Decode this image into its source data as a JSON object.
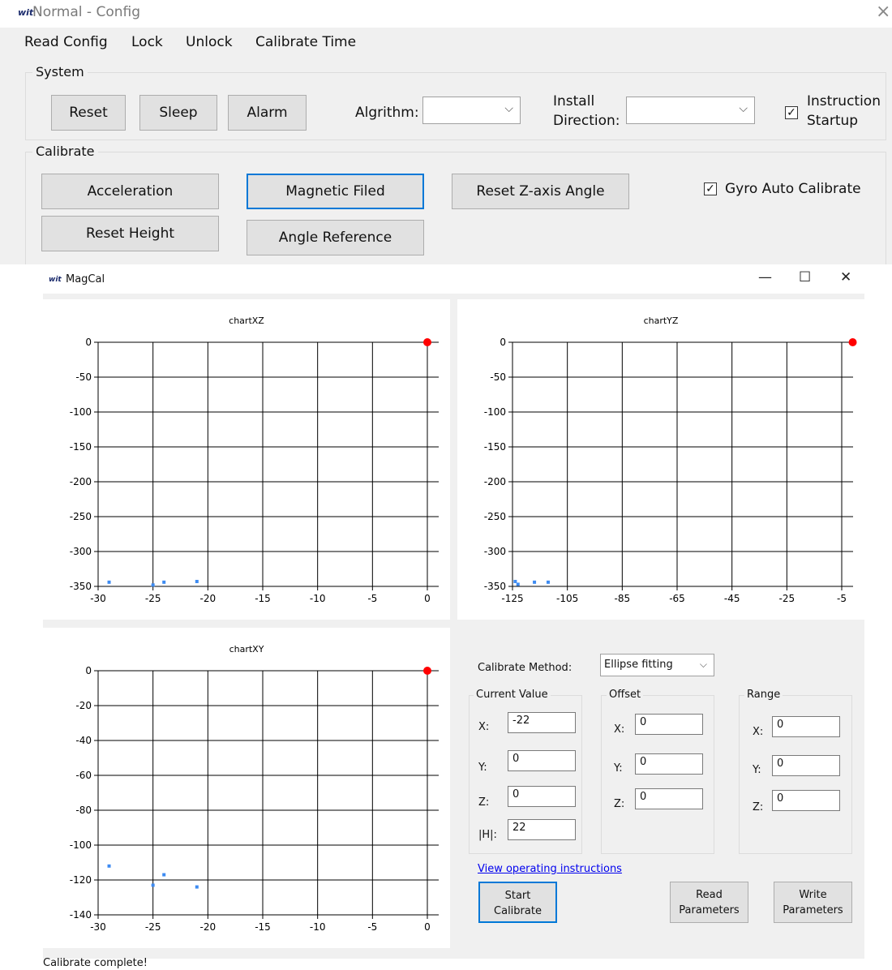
{
  "config_window": {
    "title": "Normal - Config",
    "logo_text": "wit",
    "close_glyph": "×",
    "menu": [
      "Read Config",
      "Lock",
      "Unlock",
      "Calibrate Time"
    ],
    "system": {
      "label": "System",
      "buttons": [
        "Reset",
        "Sleep",
        "Alarm"
      ],
      "algorithm_label": "Algrithm:",
      "algorithm_value": "",
      "install_label_1": "Install",
      "install_label_2": "Direction:",
      "install_value": "",
      "instruction_label_1": "Instruction",
      "instruction_label_2": "Startup",
      "instruction_checked": true
    },
    "calibrate": {
      "label": "Calibrate",
      "acceleration": "Acceleration",
      "magnetic": "Magnetic Filed",
      "reset_z": "Reset Z-axis Angle",
      "reset_height": "Reset Height",
      "angle_ref": "Angle Reference",
      "gyro_label": "Gyro Auto Calibrate",
      "gyro_checked": true
    }
  },
  "magcal_window": {
    "title": "MagCal",
    "logo_text": "wit",
    "controls": [
      "—",
      "☐",
      "✕"
    ],
    "method_label": "Calibrate Method:",
    "method_value": "Ellipse fitting",
    "current": {
      "label": "Current Value",
      "x_label": "X:",
      "x": "-22",
      "y_label": "Y:",
      "y": "0",
      "z_label": "Z:",
      "z": "0",
      "h_label": "|H|:",
      "h": "22"
    },
    "offset": {
      "label": "Offset",
      "x_label": "X:",
      "x": "0",
      "y_label": "Y:",
      "y": "0",
      "z_label": "Z:",
      "z": "0"
    },
    "range": {
      "label": "Range",
      "x_label": "X:",
      "x": "0",
      "y_label": "Y:",
      "y": "0",
      "z_label": "Z:",
      "z": "0"
    },
    "view_link": "View operating instructions",
    "start_1": "Start",
    "start_2": "Calibrate",
    "read_1": "Read",
    "read_2": "Parameters",
    "write_1": "Write",
    "write_2": "Parameters",
    "status": "Calibrate complete!"
  },
  "chart_data": [
    {
      "type": "scatter",
      "title": "chartXZ",
      "xlim": [
        -30,
        0
      ],
      "ylim": [
        -350,
        0
      ],
      "xticks": [
        -30,
        -25,
        -20,
        -15,
        -10,
        -5,
        0
      ],
      "yticks": [
        0,
        -50,
        -100,
        -150,
        -200,
        -250,
        -300,
        -350
      ],
      "grid": true,
      "series": [
        {
          "points": [
            [
              -29,
              -344
            ],
            [
              -25,
              -348
            ],
            [
              -24,
              -344
            ],
            [
              -21,
              -343
            ]
          ],
          "color": "#3d8bf2"
        },
        {
          "points": [
            [
              0,
              0
            ]
          ],
          "color": "#ff0000"
        }
      ]
    },
    {
      "type": "scatter",
      "title": "chartYZ",
      "xlim": [
        -125,
        -5
      ],
      "ylim": [
        -350,
        0
      ],
      "xticks": [
        -125,
        -105,
        -85,
        -65,
        -45,
        -25,
        -5
      ],
      "yticks": [
        0,
        -50,
        -100,
        -150,
        -200,
        -250,
        -300,
        -350
      ],
      "grid": true,
      "series": [
        {
          "points": [
            [
              -124,
              -343
            ],
            [
              -123,
              -347
            ],
            [
              -117,
              -344
            ],
            [
              -112,
              -344
            ]
          ],
          "color": "#3d8bf2"
        },
        {
          "points": [
            [
              -1,
              0
            ]
          ],
          "color": "#ff0000"
        }
      ]
    },
    {
      "type": "scatter",
      "title": "chartXY",
      "xlim": [
        -30,
        0
      ],
      "ylim": [
        -140,
        0
      ],
      "xticks": [
        -30,
        -25,
        -20,
        -15,
        -10,
        -5,
        0
      ],
      "yticks": [
        0,
        -20,
        -40,
        -60,
        -80,
        -100,
        -120,
        -140
      ],
      "grid": true,
      "series": [
        {
          "points": [
            [
              -29,
              -112
            ],
            [
              -25,
              -123
            ],
            [
              -24,
              -117
            ],
            [
              -21,
              -124
            ]
          ],
          "color": "#3d8bf2"
        },
        {
          "points": [
            [
              0,
              0
            ]
          ],
          "color": "#ff0000"
        }
      ]
    }
  ]
}
